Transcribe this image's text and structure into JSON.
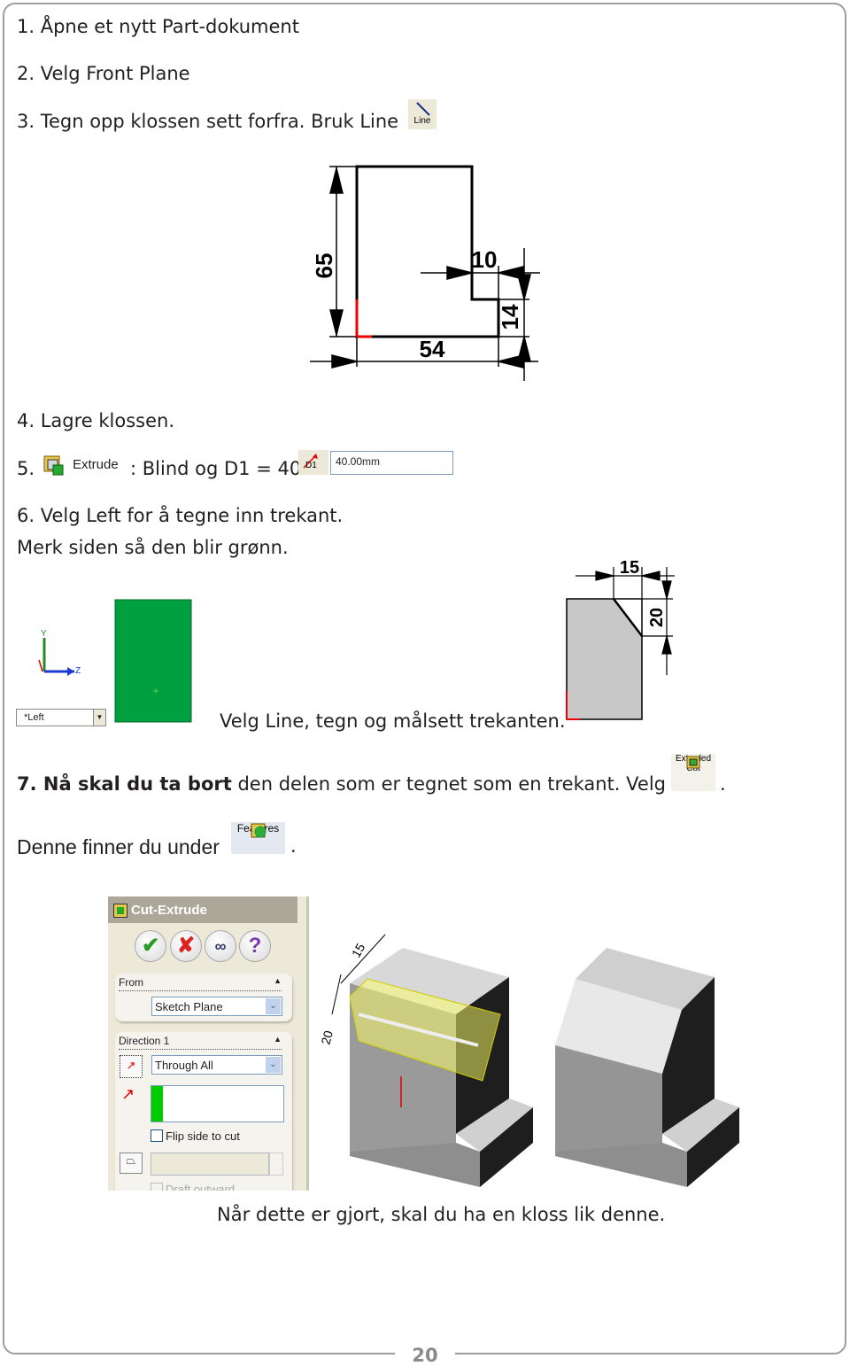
{
  "steps": {
    "s1": "1. Åpne et nytt Part-dokument",
    "s2": "2. Velg Front Plane",
    "s3": "3. Tegn opp klossen sett forfra. Bruk Line",
    "s4": "4. Lagre klossen.",
    "s5_num": "5.",
    "s5_text": ": Blind og D1 = 40",
    "s6": "6. Velg Left for å tegne inn trekant.",
    "s6_sub": "Merk siden så den blir grønn.",
    "s6_line": "Velg Line, tegn og målsett trekanten.",
    "s7_bold": "7. Nå skal du ta bort",
    "s7_rest": " den delen som er tegnet som en trekant. Velg Cut",
    "s7_end": ".",
    "s8": "Denne finner du under",
    "s8_end": ".",
    "final": "Når dette er gjort, skal du ha en kloss lik denne."
  },
  "icons": {
    "line": {
      "label": "Line",
      "icon": "line-tool-icon"
    },
    "extrude": {
      "label": "Extrude",
      "icon": "extrude-icon"
    },
    "d1": {
      "label": "D1",
      "icon": "dimension-icon"
    },
    "extruded_cut": {
      "label1": "Extruded",
      "label2": "Cut",
      "icon": "extruded-cut-icon"
    },
    "features": {
      "label": "Features",
      "icon": "features-icon"
    }
  },
  "d1_value": "40.00mm",
  "drawing1": {
    "dims": [
      "65",
      "10",
      "14",
      "54"
    ]
  },
  "drawing2": {
    "view_select": "*Left",
    "axis_y": "Y",
    "axis_z": "Z",
    "dims": [
      "15",
      "20"
    ],
    "face_color": "#00a040"
  },
  "property_manager": {
    "title": "Cut-Extrude",
    "from_label": "From",
    "from_value": "Sketch Plane",
    "direction_label": "Direction 1",
    "direction_value": "Through All",
    "flip_label": "Flip side to cut",
    "flip_checked": false,
    "draft_label": "Draft outward"
  },
  "model": {
    "dims": [
      "15",
      "20"
    ]
  },
  "page_number": "20"
}
